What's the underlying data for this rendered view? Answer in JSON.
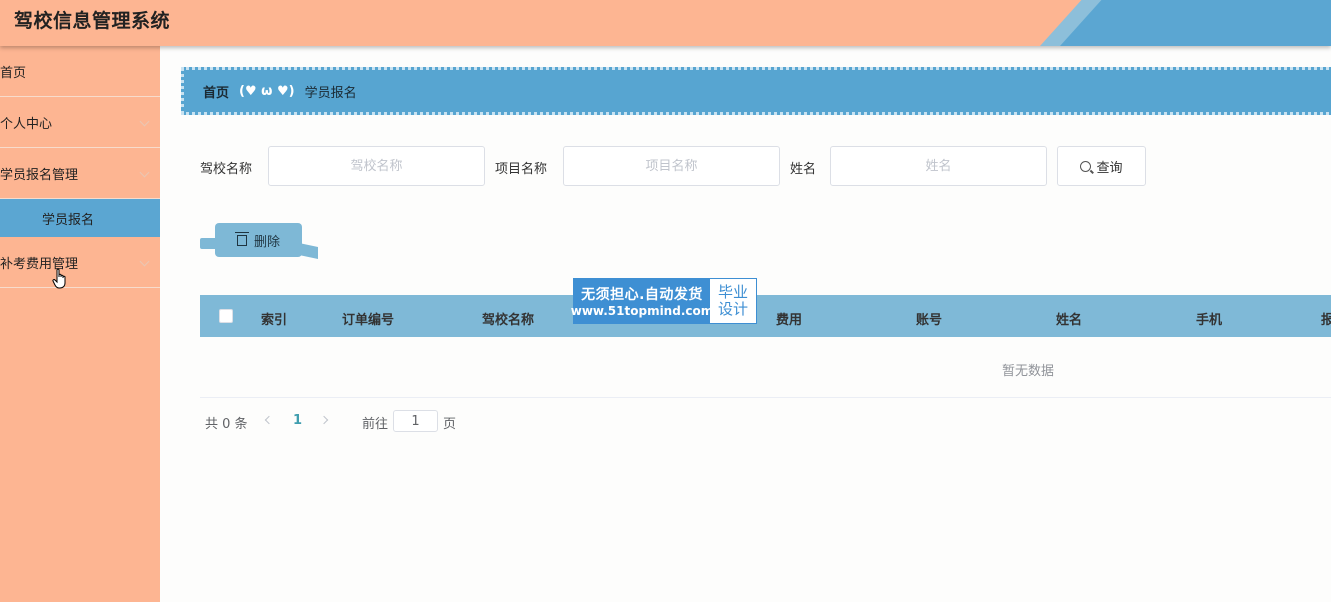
{
  "app": {
    "title": "驾校信息管理系统"
  },
  "colors": {
    "header_bg": "#fdb592",
    "accent_blue": "#5ba6d2",
    "table_head": "#7fb9d7"
  },
  "sidebar": {
    "items": [
      {
        "label": "首页"
      },
      {
        "label": "个人中心"
      },
      {
        "label": "学员报名管理"
      },
      {
        "label": "补考费用管理"
      }
    ],
    "submenu": {
      "label": "学员报名"
    }
  },
  "breadcrumb": {
    "home": "首页",
    "separator": "(♥ ω ♥)",
    "current": "学员报名"
  },
  "search": {
    "school_label": "驾校名称",
    "school_placeholder": "驾校名称",
    "project_label": "项目名称",
    "project_placeholder": "项目名称",
    "name_label": "姓名",
    "name_placeholder": "姓名",
    "query_label": "查询"
  },
  "toolbar": {
    "delete_label": "删除"
  },
  "table": {
    "columns": [
      "索引",
      "订单编号",
      "驾校名称",
      "费用",
      "账号",
      "姓名",
      "手机",
      "报"
    ],
    "empty_text": "暂无数据"
  },
  "watermark": {
    "line1": "无须担心.自动发货",
    "line2": "www.51topmind.com",
    "badge1": "毕业",
    "badge2": "设计"
  },
  "pagination": {
    "total_text": "共 0 条",
    "current_page": "1",
    "goto_label": "前往",
    "goto_value": "1",
    "page_suffix": "页"
  }
}
